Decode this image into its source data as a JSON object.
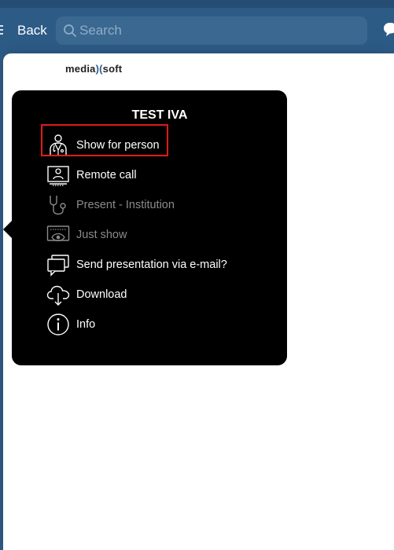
{
  "header": {
    "back_label": "Back",
    "search_placeholder": "Search"
  },
  "brand": {
    "logo_left": "media",
    "logo_mark": ")(",
    "logo_right": "soft"
  },
  "popover": {
    "title": "TEST IVA",
    "items": [
      {
        "label": "Show for person",
        "icon": "doctor-icon",
        "enabled": true,
        "highlighted": true
      },
      {
        "label": "Remote call",
        "icon": "video-call-icon",
        "enabled": true
      },
      {
        "label": "Present - Institution",
        "icon": "stethoscope-icon",
        "enabled": false
      },
      {
        "label": "Just show",
        "icon": "eye-screen-icon",
        "enabled": false
      },
      {
        "label": "Send presentation via e-mail?",
        "icon": "chat-bubbles-icon",
        "enabled": true
      },
      {
        "label": "Download",
        "icon": "cloud-download-icon",
        "enabled": true
      },
      {
        "label": "Info",
        "icon": "info-icon",
        "enabled": true
      }
    ]
  },
  "colors": {
    "navbar": "#2c5b86",
    "popover_bg": "#000000",
    "highlight": "#e01a1a",
    "disabled_text": "#8b8b8b"
  }
}
